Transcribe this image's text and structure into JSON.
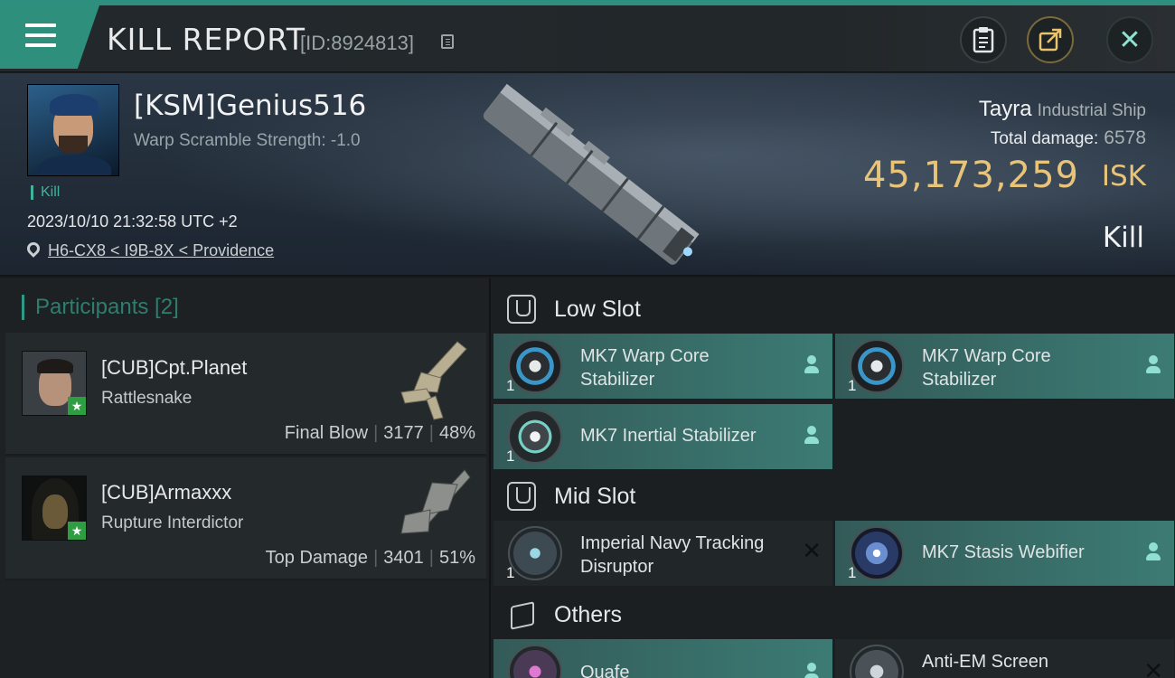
{
  "header": {
    "title": "KILL REPORT",
    "report_id": "[ID:8924813]",
    "close_symbol": "✕"
  },
  "victim": {
    "name": "[KSM]Genius516",
    "warp_scramble": "Warp Scramble Strength: -1.0",
    "tag": "Kill",
    "datetime": "2023/10/10 21:32:58 UTC +2",
    "location": "H6-CX8 < I9B-8X < Providence",
    "ship_name": "Tayra",
    "ship_class": "Industrial Ship",
    "total_damage_label": "Total damage:",
    "total_damage_value": "6578",
    "isk_value": "45,173,259",
    "isk_unit": "ISK",
    "result": "Kill"
  },
  "participants": {
    "heading": "Participants [2]",
    "rows": [
      {
        "name": "[CUB]Cpt.Planet",
        "ship": "Rattlesnake",
        "role": "Final Blow",
        "damage": "3177",
        "percent": "48%"
      },
      {
        "name": "[CUB]Armaxxx",
        "ship": "Rupture Interdictor",
        "role": "Top Damage",
        "damage": "3401",
        "percent": "51%"
      }
    ]
  },
  "fitting": {
    "low_slot": {
      "title": "Low Slot",
      "modules": [
        {
          "name": "MK7 Warp Core Stabilizer",
          "qty": "1"
        },
        {
          "name": "MK7 Warp Core Stabilizer",
          "qty": "1"
        },
        {
          "name": "MK7 Inertial Stabilizer",
          "qty": "1"
        }
      ]
    },
    "mid_slot": {
      "title": "Mid Slot",
      "modules": [
        {
          "name": "Imperial Navy Tracking Disruptor",
          "qty": "1",
          "destroyed_symbol": "✕"
        },
        {
          "name": "MK7 Stasis Webifier",
          "qty": "1"
        }
      ]
    },
    "others": {
      "title": "Others",
      "modules": [
        {
          "name": "Quafe"
        },
        {
          "name": "Anti-EM Screen",
          "destroyed_symbol": "✕"
        }
      ]
    }
  },
  "colors": {
    "accent": "#2f8f7f",
    "isk": "#e8c47a",
    "module_fitted": "#3c7b74"
  },
  "icons": [
    "menu-icon",
    "copy-icon",
    "clipboard-icon",
    "share-icon",
    "close-icon",
    "location-pin-icon",
    "star-icon",
    "pilot-icon",
    "low-slot-icon",
    "mid-slot-icon",
    "cargo-box-icon"
  ]
}
